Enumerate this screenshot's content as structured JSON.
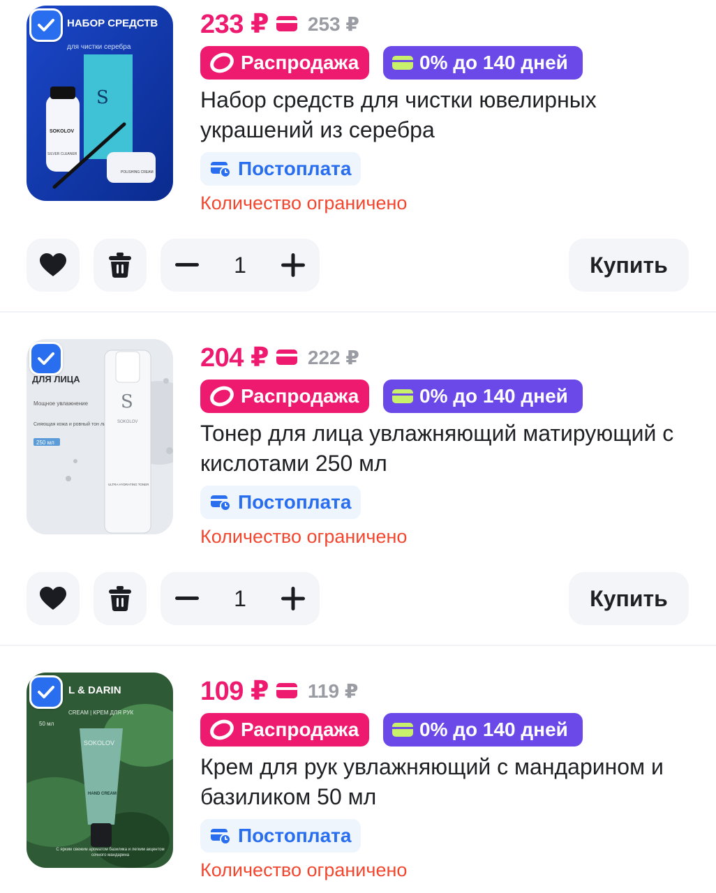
{
  "colors": {
    "price": "#ee1a6f",
    "sale_badge": "#ee1a6f",
    "install_badge": "#6a49e8",
    "postpay_text": "#2a6ef0",
    "postpay_bg": "#eef5fd",
    "limited": "#f2462f",
    "checkbox": "#2a6ef0"
  },
  "items": [
    {
      "selected": true,
      "image": {
        "icon": "silver-cleaning-set-photo",
        "headline": "НАБОР СРЕДСТВ",
        "subline": "для чистки серебра",
        "brand": "SOKOLOV",
        "bottle_label": "SILVER CLEANER",
        "jar_label": "POLISHING CREAM"
      },
      "price": "233 ₽",
      "old_price": "253 ₽",
      "badge_sale": "Распродажа",
      "badge_install": "0% до 140 дней",
      "title": "Набор средств для чистки ювелирных украшений из серебра",
      "postpay": "Постоплата",
      "limited": "Количество ограничено",
      "quantity": "1",
      "buy_label": "Купить"
    },
    {
      "selected": true,
      "image": {
        "icon": "face-toner-photo",
        "headline": "ДЛЯ ЛИЦА",
        "line1": "Мощное увлажнение",
        "line2": "Сияющая кожа и ровный тон лица",
        "volume": "250 мл",
        "brand": "SOKOLOV",
        "bottle_label": "ULTRA HYDRATING TONER"
      },
      "price": "204 ₽",
      "old_price": "222 ₽",
      "badge_sale": "Распродажа",
      "badge_install": "0% до 140 дней",
      "title": "Тонер для лица увлажняющий матирующий с кислотами 250 мл",
      "postpay": "Постоплата",
      "limited": "Количество ограничено",
      "quantity": "1",
      "buy_label": "Купить"
    },
    {
      "selected": true,
      "image": {
        "icon": "hand-cream-photo",
        "headline": "L & DARIN",
        "subline": "CREAM | КРЕМ ДЛЯ РУК",
        "volume": "50 мл",
        "brand": "SOKOLOV",
        "tube_label": "HAND CREAM",
        "caption": "С ярким свежим ароматом базилика и легким акцентом сочного мандарина"
      },
      "price": "109 ₽",
      "old_price": "119 ₽",
      "badge_sale": "Распродажа",
      "badge_install": "0% до 140 дней",
      "title": "Крем для рук увлажняющий с мандарином и базиликом 50 мл",
      "postpay": "Постоплата",
      "limited": "Количество ограничено"
    }
  ]
}
